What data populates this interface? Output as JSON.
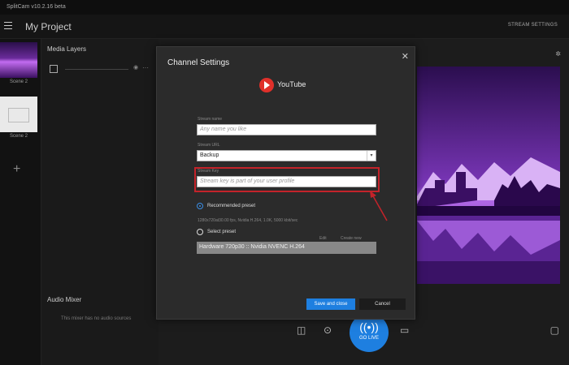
{
  "titlebar": {
    "text": "SplitCam v10.2.16 beta"
  },
  "appbar": {
    "project": "My Project",
    "stream_settings": "STREAM SETTINGS"
  },
  "scenes": [
    {
      "label": "Scene 2"
    },
    {
      "label": "Scene 2"
    }
  ],
  "layers": {
    "title": "Media Layers"
  },
  "mixer": {
    "title": "Audio Mixer",
    "empty": "This mixer has no audio sources"
  },
  "modal": {
    "title": "Channel Settings",
    "close": "✕",
    "service": "YouTube",
    "stream_name": {
      "label": "Stream name",
      "placeholder": "Any name you like"
    },
    "stream_url": {
      "label": "Stream URL",
      "value": "Backup"
    },
    "stream_key": {
      "label": "Stream Key",
      "placeholder": "Stream key is part of your user profile"
    },
    "recommended": {
      "label": "Recommended preset",
      "details": "1280x720at30.00 fps, Nvidia H.264, 1.0K, 5000 kbit/sec"
    },
    "select_preset": {
      "label": "Select preset",
      "col1": "Edit",
      "col2": "Create new",
      "value": "Hardware 720p30 :: Nvidia NVENC H.264"
    },
    "save": "Save and close",
    "cancel": "Cancel"
  },
  "golive": {
    "label": "GO LIVE"
  },
  "icons": {
    "accent": "#1e7fe0",
    "highlight": "#c4232a",
    "youtube": "#e0302a"
  }
}
